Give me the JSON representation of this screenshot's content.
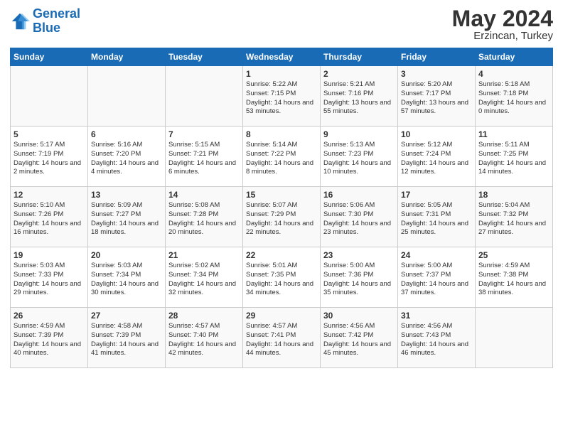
{
  "header": {
    "logo_line1": "General",
    "logo_line2": "Blue",
    "month": "May 2024",
    "location": "Erzincan, Turkey"
  },
  "days_of_week": [
    "Sunday",
    "Monday",
    "Tuesday",
    "Wednesday",
    "Thursday",
    "Friday",
    "Saturday"
  ],
  "weeks": [
    [
      {
        "day": "",
        "sunrise": "",
        "sunset": "",
        "daylight": ""
      },
      {
        "day": "",
        "sunrise": "",
        "sunset": "",
        "daylight": ""
      },
      {
        "day": "",
        "sunrise": "",
        "sunset": "",
        "daylight": ""
      },
      {
        "day": "1",
        "sunrise": "Sunrise: 5:22 AM",
        "sunset": "Sunset: 7:15 PM",
        "daylight": "Daylight: 14 hours and 53 minutes."
      },
      {
        "day": "2",
        "sunrise": "Sunrise: 5:21 AM",
        "sunset": "Sunset: 7:16 PM",
        "daylight": "Daylight: 13 hours and 55 minutes."
      },
      {
        "day": "3",
        "sunrise": "Sunrise: 5:20 AM",
        "sunset": "Sunset: 7:17 PM",
        "daylight": "Daylight: 13 hours and 57 minutes."
      },
      {
        "day": "4",
        "sunrise": "Sunrise: 5:18 AM",
        "sunset": "Sunset: 7:18 PM",
        "daylight": "Daylight: 14 hours and 0 minutes."
      }
    ],
    [
      {
        "day": "5",
        "sunrise": "Sunrise: 5:17 AM",
        "sunset": "Sunset: 7:19 PM",
        "daylight": "Daylight: 14 hours and 2 minutes."
      },
      {
        "day": "6",
        "sunrise": "Sunrise: 5:16 AM",
        "sunset": "Sunset: 7:20 PM",
        "daylight": "Daylight: 14 hours and 4 minutes."
      },
      {
        "day": "7",
        "sunrise": "Sunrise: 5:15 AM",
        "sunset": "Sunset: 7:21 PM",
        "daylight": "Daylight: 14 hours and 6 minutes."
      },
      {
        "day": "8",
        "sunrise": "Sunrise: 5:14 AM",
        "sunset": "Sunset: 7:22 PM",
        "daylight": "Daylight: 14 hours and 8 minutes."
      },
      {
        "day": "9",
        "sunrise": "Sunrise: 5:13 AM",
        "sunset": "Sunset: 7:23 PM",
        "daylight": "Daylight: 14 hours and 10 minutes."
      },
      {
        "day": "10",
        "sunrise": "Sunrise: 5:12 AM",
        "sunset": "Sunset: 7:24 PM",
        "daylight": "Daylight: 14 hours and 12 minutes."
      },
      {
        "day": "11",
        "sunrise": "Sunrise: 5:11 AM",
        "sunset": "Sunset: 7:25 PM",
        "daylight": "Daylight: 14 hours and 14 minutes."
      }
    ],
    [
      {
        "day": "12",
        "sunrise": "Sunrise: 5:10 AM",
        "sunset": "Sunset: 7:26 PM",
        "daylight": "Daylight: 14 hours and 16 minutes."
      },
      {
        "day": "13",
        "sunrise": "Sunrise: 5:09 AM",
        "sunset": "Sunset: 7:27 PM",
        "daylight": "Daylight: 14 hours and 18 minutes."
      },
      {
        "day": "14",
        "sunrise": "Sunrise: 5:08 AM",
        "sunset": "Sunset: 7:28 PM",
        "daylight": "Daylight: 14 hours and 20 minutes."
      },
      {
        "day": "15",
        "sunrise": "Sunrise: 5:07 AM",
        "sunset": "Sunset: 7:29 PM",
        "daylight": "Daylight: 14 hours and 22 minutes."
      },
      {
        "day": "16",
        "sunrise": "Sunrise: 5:06 AM",
        "sunset": "Sunset: 7:30 PM",
        "daylight": "Daylight: 14 hours and 23 minutes."
      },
      {
        "day": "17",
        "sunrise": "Sunrise: 5:05 AM",
        "sunset": "Sunset: 7:31 PM",
        "daylight": "Daylight: 14 hours and 25 minutes."
      },
      {
        "day": "18",
        "sunrise": "Sunrise: 5:04 AM",
        "sunset": "Sunset: 7:32 PM",
        "daylight": "Daylight: 14 hours and 27 minutes."
      }
    ],
    [
      {
        "day": "19",
        "sunrise": "Sunrise: 5:03 AM",
        "sunset": "Sunset: 7:33 PM",
        "daylight": "Daylight: 14 hours and 29 minutes."
      },
      {
        "day": "20",
        "sunrise": "Sunrise: 5:03 AM",
        "sunset": "Sunset: 7:34 PM",
        "daylight": "Daylight: 14 hours and 30 minutes."
      },
      {
        "day": "21",
        "sunrise": "Sunrise: 5:02 AM",
        "sunset": "Sunset: 7:34 PM",
        "daylight": "Daylight: 14 hours and 32 minutes."
      },
      {
        "day": "22",
        "sunrise": "Sunrise: 5:01 AM",
        "sunset": "Sunset: 7:35 PM",
        "daylight": "Daylight: 14 hours and 34 minutes."
      },
      {
        "day": "23",
        "sunrise": "Sunrise: 5:00 AM",
        "sunset": "Sunset: 7:36 PM",
        "daylight": "Daylight: 14 hours and 35 minutes."
      },
      {
        "day": "24",
        "sunrise": "Sunrise: 5:00 AM",
        "sunset": "Sunset: 7:37 PM",
        "daylight": "Daylight: 14 hours and 37 minutes."
      },
      {
        "day": "25",
        "sunrise": "Sunrise: 4:59 AM",
        "sunset": "Sunset: 7:38 PM",
        "daylight": "Daylight: 14 hours and 38 minutes."
      }
    ],
    [
      {
        "day": "26",
        "sunrise": "Sunrise: 4:59 AM",
        "sunset": "Sunset: 7:39 PM",
        "daylight": "Daylight: 14 hours and 40 minutes."
      },
      {
        "day": "27",
        "sunrise": "Sunrise: 4:58 AM",
        "sunset": "Sunset: 7:39 PM",
        "daylight": "Daylight: 14 hours and 41 minutes."
      },
      {
        "day": "28",
        "sunrise": "Sunrise: 4:57 AM",
        "sunset": "Sunset: 7:40 PM",
        "daylight": "Daylight: 14 hours and 42 minutes."
      },
      {
        "day": "29",
        "sunrise": "Sunrise: 4:57 AM",
        "sunset": "Sunset: 7:41 PM",
        "daylight": "Daylight: 14 hours and 44 minutes."
      },
      {
        "day": "30",
        "sunrise": "Sunrise: 4:56 AM",
        "sunset": "Sunset: 7:42 PM",
        "daylight": "Daylight: 14 hours and 45 minutes."
      },
      {
        "day": "31",
        "sunrise": "Sunrise: 4:56 AM",
        "sunset": "Sunset: 7:43 PM",
        "daylight": "Daylight: 14 hours and 46 minutes."
      },
      {
        "day": "",
        "sunrise": "",
        "sunset": "",
        "daylight": ""
      }
    ]
  ]
}
